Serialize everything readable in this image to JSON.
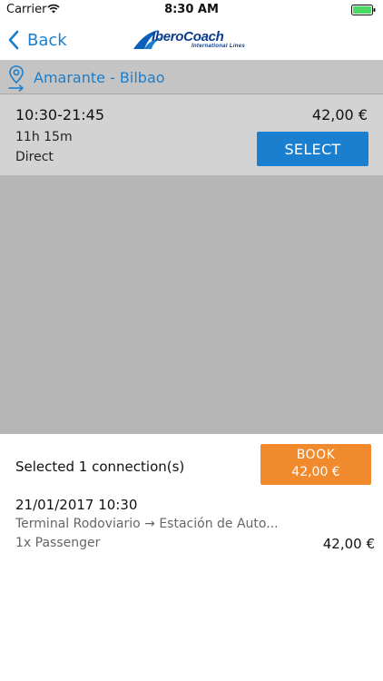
{
  "status_bar": {
    "carrier": "Carrier",
    "time": "8:30 AM"
  },
  "nav": {
    "back_label": "Back",
    "logo_text": "IberoCoach",
    "logo_subtext": "International Lines"
  },
  "route": {
    "label": "Amarante - Bilbao"
  },
  "trips": [
    {
      "times": "10:30-21:45",
      "duration": "11h 15m",
      "type": "Direct",
      "price": "42,00 €",
      "select_label": "SELECT"
    }
  ],
  "summary": {
    "title": "Selected 1 connection(s)",
    "book_label": "BOOK",
    "book_price": "42,00 €",
    "selection": {
      "date": "21/01/2017 10:30",
      "route": "Terminal Rodoviario → Estación de Auto...",
      "passengers": "1x Passenger",
      "price": "42,00 €"
    }
  },
  "colors": {
    "accent": "#1a7fcf",
    "book": "#f08a2c",
    "results_bg": "#b6b6b6"
  }
}
